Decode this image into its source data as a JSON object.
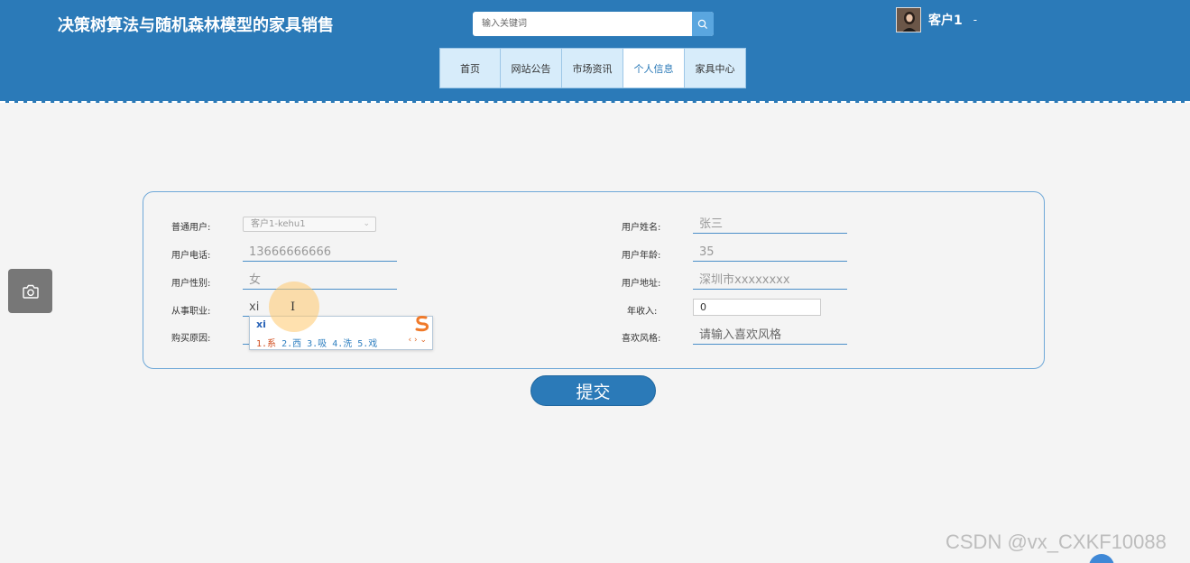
{
  "header": {
    "site_title": "决策树算法与随机森林模型的家具销售",
    "search_placeholder": "输入关键词",
    "user_name": "客户1",
    "user_caret": "-"
  },
  "nav": {
    "items": [
      {
        "label": "首页",
        "active": false
      },
      {
        "label": "网站公告",
        "active": false
      },
      {
        "label": "市场资讯",
        "active": false
      },
      {
        "label": "个人信息",
        "active": true
      },
      {
        "label": "家具中心",
        "active": false
      }
    ]
  },
  "form": {
    "user_type": {
      "label": "普通用户:",
      "value": "客户1-kehu1"
    },
    "phone": {
      "label": "用户电话:",
      "value": "13666666666"
    },
    "gender": {
      "label": "用户性别:",
      "value": "女"
    },
    "occupation": {
      "label": "从事职业:",
      "value": "xi"
    },
    "purchase_reason": {
      "label": "购买原因:",
      "value": ""
    },
    "name": {
      "label": "用户姓名:",
      "value": "张三"
    },
    "age": {
      "label": "用户年龄:",
      "value": "35"
    },
    "address": {
      "label": "用户地址:",
      "value": "深圳市xxxxxxxx"
    },
    "income": {
      "label": "年收入:",
      "value": "0"
    },
    "style": {
      "label": "喜欢风格:",
      "placeholder": "请输入喜欢风格"
    }
  },
  "ime": {
    "typed": "xi",
    "first_candidate": "1.系",
    "other_candidates": "2.西 3.吸 4.洗 5.戏",
    "nav": "‹ › ⌄"
  },
  "submit_label": "提交",
  "watermark": "CSDN @vx_CXKF10088"
}
